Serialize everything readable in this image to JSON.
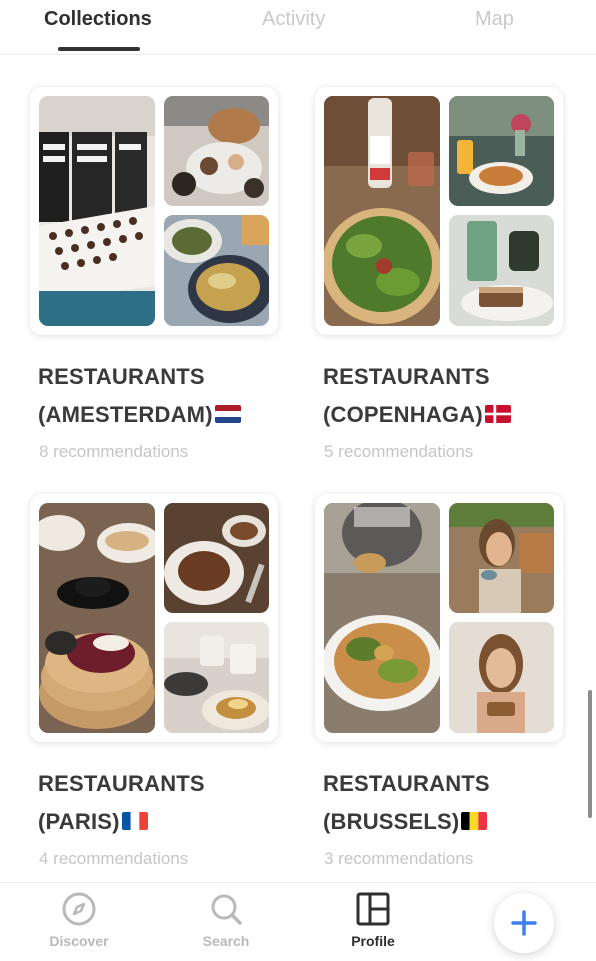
{
  "tabs": [
    {
      "label": "Collections",
      "active": true
    },
    {
      "label": "Activity",
      "active": false
    },
    {
      "label": "Map",
      "active": false
    }
  ],
  "collections": [
    {
      "title_line1": "RESTAURANTS",
      "title_line2": "(AMESTERDAM)",
      "flag": "netherlands-flag",
      "count": "8 recommendations"
    },
    {
      "title_line1": "RESTAURANTS",
      "title_line2": "(COPENHAGA)",
      "flag": "denmark-flag",
      "count": "5 recommendations"
    },
    {
      "title_line1": "RESTAURANTS",
      "title_line2": "(PARIS)",
      "flag": "france-flag",
      "count": "4 recommendations"
    },
    {
      "title_line1": "RESTAURANTS",
      "title_line2": "(BRUSSELS)",
      "flag": "belgium-flag",
      "count": "3 recommendations"
    }
  ],
  "nav": {
    "items": [
      {
        "label": "Discover",
        "icon": "compass-icon",
        "active": false
      },
      {
        "label": "Search",
        "icon": "search-icon",
        "active": false
      },
      {
        "label": "Profile",
        "icon": "layout-grid-icon",
        "active": true
      }
    ],
    "add_button_icon": "plus-icon"
  },
  "colors": {
    "active_text": "#2f2f2f",
    "inactive_text": "#c9c9c9",
    "accent": "#3d7ff0"
  }
}
